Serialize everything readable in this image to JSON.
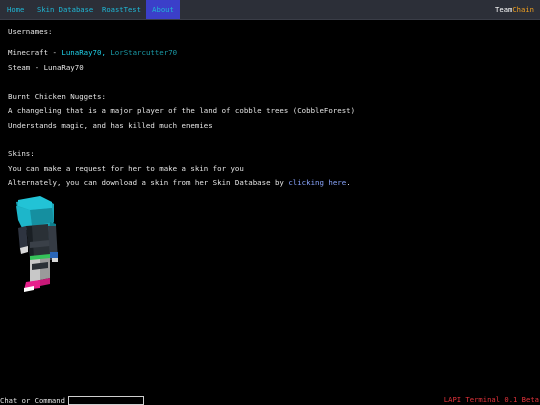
{
  "nav": {
    "items": [
      {
        "label": "Home"
      },
      {
        "label": "Skin Database"
      },
      {
        "label": "RoastTest"
      },
      {
        "label": "About"
      }
    ],
    "active_index": 3,
    "brand_part1": "Team",
    "brand_part2": "Chain"
  },
  "usernames": {
    "heading": "Usernames:",
    "minecraft_prefix": "Minecraft - ",
    "minecraft_user1": "LunaRay70,",
    "minecraft_user2": "LorStarcutter70",
    "steam": "Steam - LunaRay70"
  },
  "nuggets": {
    "heading": "Burnt Chicken Nuggets:",
    "line1": "A changeling that is a major player of the land of cobble trees (CobbleForest)",
    "line2": "Understands magic, and has killed much enemies"
  },
  "skins": {
    "heading": "Skins:",
    "line1": "You can make a request for her to make a skin for you",
    "line2_prefix": "Alternately, you can download a skin from her Skin Database by ",
    "line2_link": "clicking here",
    "line2_suffix": "."
  },
  "footer": {
    "command_label": "Chat or Command >",
    "version": "LAPI Terminal 0.1 Beta"
  },
  "colors": {
    "nav_bg": "#2c2f38",
    "nav_text": "#1fb8d6",
    "nav_active_bg": "#3b3fc9",
    "brand_accent": "#f0a020",
    "username_cyan": "#1fd0e8",
    "username_teal": "#1a9aa6",
    "link": "#8aa6ff",
    "version_red": "#e0323a"
  }
}
